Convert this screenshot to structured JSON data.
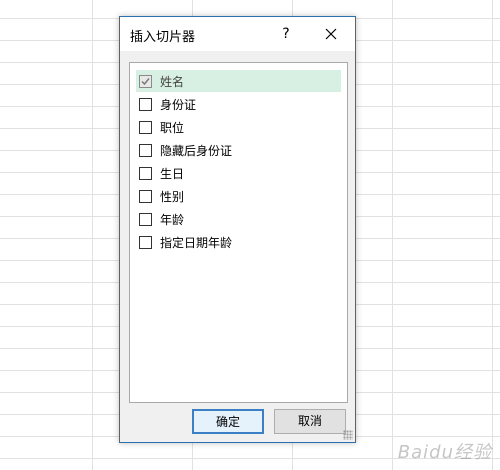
{
  "dialog": {
    "title": "插入切片器",
    "help_label": "?",
    "items": [
      {
        "label": "姓名",
        "checked": true,
        "selected": true
      },
      {
        "label": "身份证",
        "checked": false,
        "selected": false
      },
      {
        "label": "职位",
        "checked": false,
        "selected": false
      },
      {
        "label": "隐藏后身份证",
        "checked": false,
        "selected": false
      },
      {
        "label": "生日",
        "checked": false,
        "selected": false
      },
      {
        "label": "性别",
        "checked": false,
        "selected": false
      },
      {
        "label": "年龄",
        "checked": false,
        "selected": false
      },
      {
        "label": "指定日期年龄",
        "checked": false,
        "selected": false
      }
    ],
    "ok_label": "确定",
    "cancel_label": "取消"
  },
  "watermark": "Baidu经验",
  "colors": {
    "selected_row": "#d8efe3",
    "dialog_border": "#2a6fb0",
    "ok_border": "#3b7fc4"
  },
  "icons": [
    "help-icon",
    "close-icon",
    "check-icon",
    "resize-grip-icon"
  ]
}
